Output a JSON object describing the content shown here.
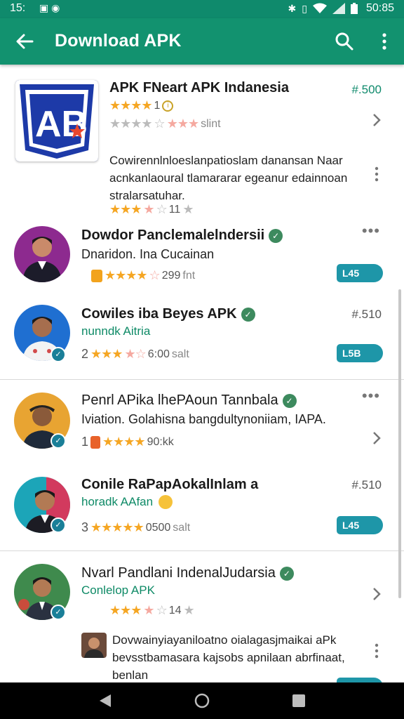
{
  "status_bar": {
    "time_left": "15:",
    "time": "50:85",
    "icons": [
      "gallery-icon",
      "circle-icon",
      "bluetooth-icon",
      "vibrate-icon",
      "wifi-icon",
      "signal-icon",
      "battery-icon"
    ]
  },
  "app_bar": {
    "title": "Download APK",
    "icons": [
      "back-arrow-icon",
      "search-icon",
      "more-vert-icon"
    ],
    "color": "#12926f"
  },
  "featured": {
    "title": "APK FNeart APK Indanesia",
    "price": "#.500",
    "rating_count": "1",
    "rating_label": "slint",
    "description": "Cowirennlnloeslanpatioslam danansan Naar acnkanlaoural tlamararar egeanur edainnoan stralarsatuhar.",
    "review_count": "11"
  },
  "items": [
    {
      "title": "Dowdor Panclemalelndersii",
      "subtitle": "Dnaridon. Ina Cucainan",
      "rating_count": "299",
      "rating_label": "fnt",
      "badge": "L45",
      "avatar_color": "#8d2a8f"
    },
    {
      "title": "Cowiles iba Beyes APK",
      "developer": "nunndk Aitria",
      "price": "#.510",
      "rating_prefix": "2",
      "rating_count": "6:00",
      "rating_label": "salt",
      "badge": "L5B",
      "avatar_color": "#1f6fd1"
    },
    {
      "title": "Penrl APika lhePAoun Tannbala",
      "subtitle": "Iviation. Golahisna bangdultynoniiam, IAPA.",
      "rating_prefix": "1",
      "rating_count": "90:kk",
      "avatar_color": "#e8a432"
    },
    {
      "title": "Conile RaPapAokalInlam a",
      "developer": "horadk AAfan",
      "price": "#.510",
      "rating_prefix": "3",
      "rating_count": "0500",
      "rating_label": "salt",
      "badge": "L45",
      "avatar_color": "#1ca5b8"
    },
    {
      "title": "Nvarl Pandlani IndenalJudarsia",
      "developer": "Conlelop APK",
      "rating_count": "14",
      "description": "Dovwainyiayaniloatno oialagasjmaikai aPk bevsstbamasara kajsobs apnilaan abrfinaat, benlan",
      "avatar_color": "#3f8a4d"
    }
  ]
}
